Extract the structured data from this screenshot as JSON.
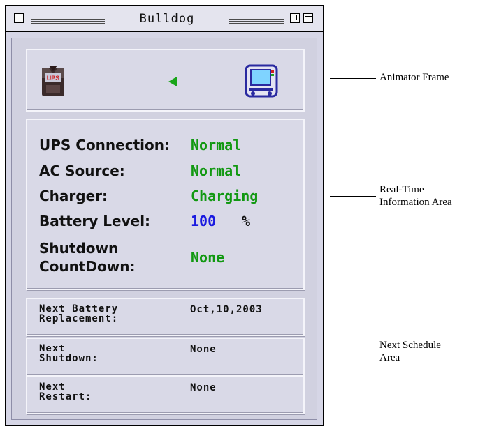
{
  "window": {
    "title": "Bulldog"
  },
  "realtime": {
    "rows": [
      {
        "label": "UPS Connection:",
        "value": "Normal"
      },
      {
        "label": "AC Source:",
        "value": "Normal"
      },
      {
        "label": "Charger:",
        "value": "Charging"
      },
      {
        "label": "Battery Level:",
        "value": "100",
        "unit": "%"
      },
      {
        "label": "Shutdown\nCountDown:",
        "value": "None"
      }
    ]
  },
  "schedule": [
    {
      "label": "Next Battery\nReplacement:",
      "value": "Oct,10,2003"
    },
    {
      "label": "Next\nShutdown:",
      "value": "None"
    },
    {
      "label": "Next\nRestart:",
      "value": "None"
    }
  ],
  "callouts": {
    "animator": "Animator Frame",
    "realtime": "Real-Time\nInformation Area",
    "schedule": "Next Schedule\nArea"
  },
  "icons": {
    "ups": "ups-icon",
    "arrow": "arrow-left-icon",
    "computer": "computer-icon"
  },
  "colors": {
    "status_green": "#119811",
    "level_blue": "#1a1ae0"
  }
}
